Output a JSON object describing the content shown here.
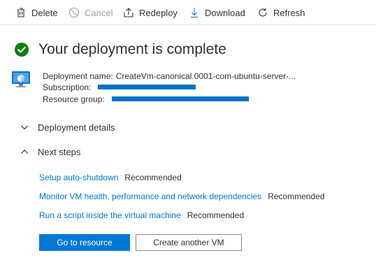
{
  "toolbar": {
    "delete_label": "Delete",
    "cancel_label": "Cancel",
    "redeploy_label": "Redeploy",
    "download_label": "Download",
    "refresh_label": "Refresh"
  },
  "header": {
    "title": "Your deployment is complete",
    "status_icon": "success-check-icon"
  },
  "deployment": {
    "icon": "virtual-machine-icon",
    "name_label": "Deployment name:",
    "name_value": "CreateVm-canonical.0001-com-ubuntu-server-...",
    "subscription_label": "Subscription:",
    "resource_group_label": "Resource group:"
  },
  "sections": {
    "details_label": "Deployment details",
    "next_steps_label": "Next steps"
  },
  "next_steps": [
    {
      "link": "Setup auto-shutdown",
      "badge": "Recommended"
    },
    {
      "link": "Monitor VM health, performance and network dependencies",
      "badge": "Recommended"
    },
    {
      "link": "Run a script inside the virtual machine",
      "badge": "Recommended"
    }
  ],
  "buttons": {
    "go_to_resource": "Go to resource",
    "create_another": "Create another VM"
  },
  "colors": {
    "accent": "#0078d4",
    "success": "#107c10",
    "redaction": "#0072c6"
  }
}
